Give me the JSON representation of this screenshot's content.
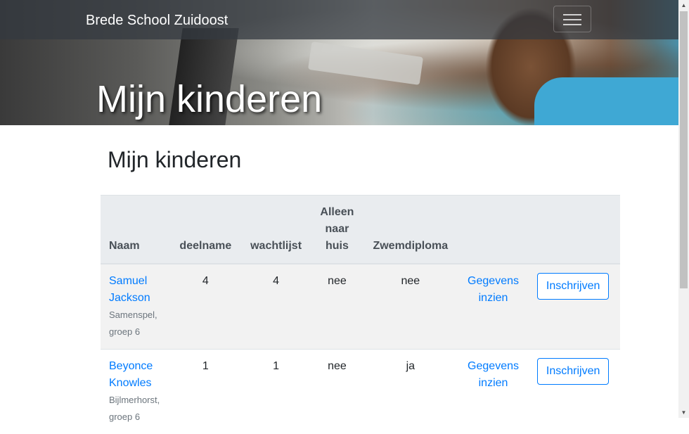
{
  "navbar": {
    "brand": "Brede School Zuidoost"
  },
  "hero": {
    "title": "Mijn kinderen"
  },
  "main": {
    "title": "Mijn kinderen",
    "table": {
      "headers": {
        "naam": "Naam",
        "deelname": "deelname",
        "wachtlijst": "wachtlijst",
        "alleen_line1": "Alleen",
        "alleen_line2": "naar",
        "alleen_line3": "huis",
        "zwemdiploma": "Zwemdiploma"
      },
      "rows": [
        {
          "first": "Samuel",
          "last": "Jackson",
          "school_line1": "Samenspel,",
          "school_line2": "groep 6",
          "deelname": "4",
          "wachtlijst": "4",
          "alleen": "nee",
          "zwemdiploma": "nee",
          "view_line1": "Gegevens",
          "view_line2": "inzien",
          "enroll": "Inschrijven"
        },
        {
          "first": "Beyonce",
          "last": "Knowles",
          "school_line1": "Bijlmerhorst,",
          "school_line2": "groep 6",
          "deelname": "1",
          "wachtlijst": "1",
          "alleen": "nee",
          "zwemdiploma": "ja",
          "view_line1": "Gegevens",
          "view_line2": "inzien",
          "enroll": "Inschrijven"
        }
      ]
    }
  },
  "icons": {
    "menu": "hamburger-icon",
    "scroll_up": "arrow-up-icon",
    "scroll_down": "arrow-down-icon"
  },
  "colors": {
    "link": "#007bff",
    "navbar": "#343a40",
    "header_bg": "#e9ecef",
    "row_stripe": "#f2f2f2"
  }
}
